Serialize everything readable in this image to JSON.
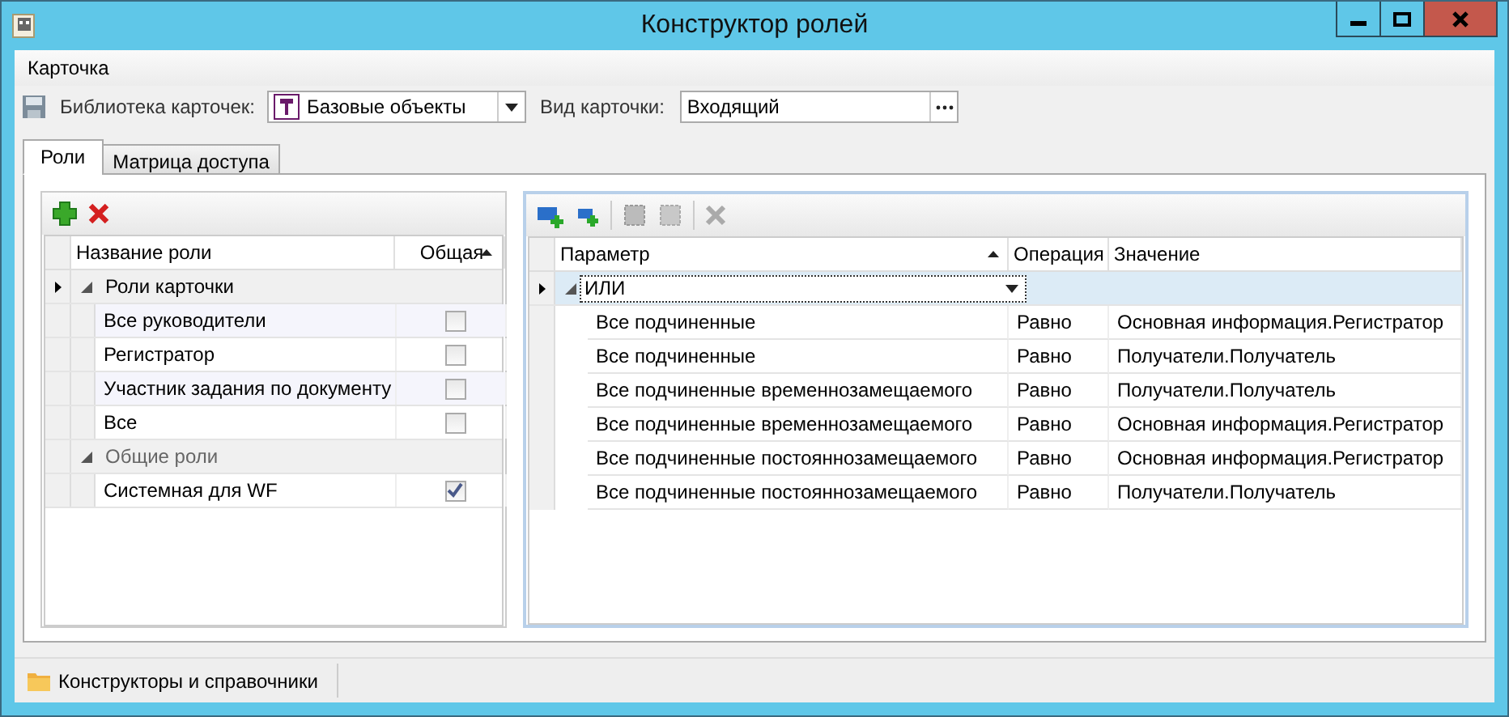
{
  "window": {
    "title": "Конструктор ролей"
  },
  "menu": [
    {
      "label": "Карточка"
    }
  ],
  "toolbar": {
    "library_label": "Библиотека карточек:",
    "library_value": "Базовые объекты",
    "view_label": "Вид карточки:",
    "view_value": "Входящий"
  },
  "tabs": [
    {
      "label": "Роли",
      "selected": true
    },
    {
      "label": "Матрица доступа",
      "selected": false
    }
  ],
  "roles": {
    "columns": [
      "Название роли",
      "Общая"
    ],
    "groups": [
      {
        "name": "Роли карточки",
        "expanded": true,
        "current": true,
        "rows": [
          {
            "name": "Все руководители",
            "shared": false
          },
          {
            "name": "Регистратор",
            "shared": false
          },
          {
            "name": "Участник задания по документу",
            "shared": false
          },
          {
            "name": "Все",
            "shared": false
          }
        ]
      },
      {
        "name": "Общие роли",
        "expanded": true,
        "current": false,
        "rows": [
          {
            "name": "Системная для WF",
            "shared": true
          }
        ]
      }
    ]
  },
  "conditions": {
    "columns": [
      "Параметр",
      "Операция",
      "Значение"
    ],
    "root": {
      "operator": "ИЛИ",
      "expanded": true
    },
    "rows": [
      {
        "parameter": "Все подчиненные",
        "operation": "Равно",
        "value": "Основная информация.Регистратор"
      },
      {
        "parameter": "Все подчиненные",
        "operation": "Равно",
        "value": "Получатели.Получатель"
      },
      {
        "parameter": "Все подчиненные временнозамещаемого",
        "operation": "Равно",
        "value": "Получатели.Получатель"
      },
      {
        "parameter": "Все подчиненные временнозамещаемого",
        "operation": "Равно",
        "value": "Основная информация.Регистратор"
      },
      {
        "parameter": "Все подчиненные постояннозамещаемого",
        "operation": "Равно",
        "value": "Основная информация.Регистратор"
      },
      {
        "parameter": "Все подчиненные постояннозамещаемого",
        "operation": "Равно",
        "value": "Получатели.Получатель"
      }
    ]
  },
  "status_bar": [
    {
      "label": "Конструкторы и справочники"
    }
  ]
}
